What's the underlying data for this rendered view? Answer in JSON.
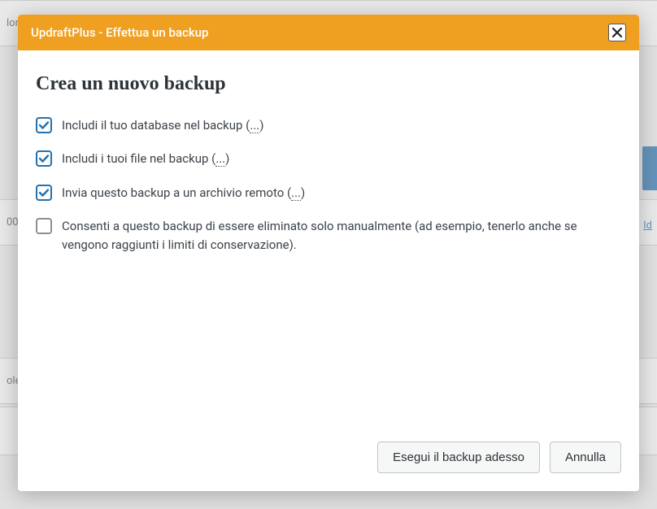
{
  "background": {
    "row1_text": "lor",
    "row2_text": "00",
    "row3_text": "ole",
    "side_link": "Id"
  },
  "dialog": {
    "title": "UpdraftPlus - Effettua un backup",
    "heading": "Crea un nuovo backup",
    "options": [
      {
        "checked": true,
        "label_pre": "Includi il tuo database nel backup (",
        "label_link": "...",
        "label_post": ")"
      },
      {
        "checked": true,
        "label_pre": "Includi i tuoi file nel backup (",
        "label_link": "...",
        "label_post": ")"
      },
      {
        "checked": true,
        "label_pre": "Invia questo backup a un archivio remoto (",
        "label_link": "...",
        "label_post": ")"
      },
      {
        "checked": false,
        "label_pre": "Consenti a questo backup di essere eliminato solo manualmente (ad esempio, tenerlo anche se vengono raggiunti i limiti di conservazione).",
        "label_link": "",
        "label_post": ""
      }
    ],
    "buttons": {
      "primary": "Esegui il backup adesso",
      "cancel": "Annulla"
    }
  }
}
